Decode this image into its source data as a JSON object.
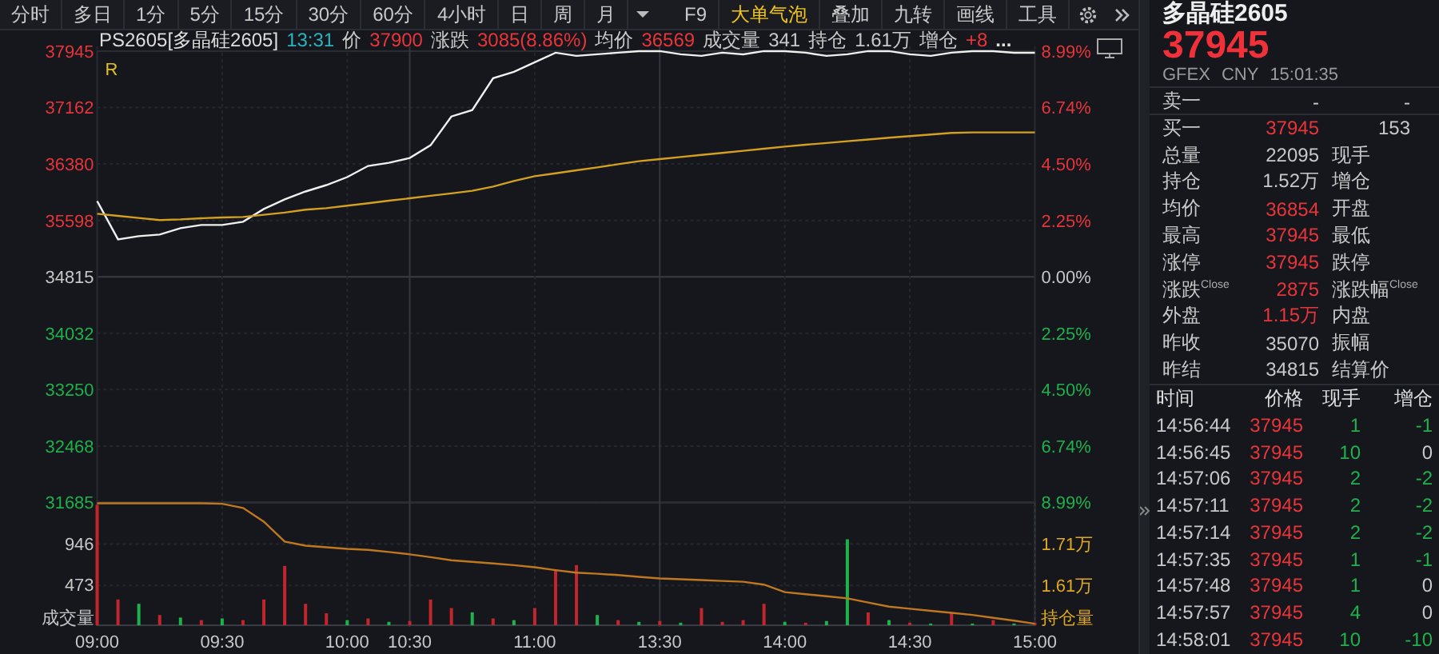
{
  "toolbar": {
    "items": [
      {
        "label": "分时",
        "active": false
      },
      {
        "label": "多日",
        "active": false
      },
      {
        "label": "1分",
        "active": false
      },
      {
        "label": "5分",
        "active": false
      },
      {
        "label": "15分",
        "active": false
      },
      {
        "label": "30分",
        "active": false
      },
      {
        "label": "60分",
        "active": false
      },
      {
        "label": "4小时",
        "active": false
      },
      {
        "label": "日",
        "active": false
      },
      {
        "label": "周",
        "active": false
      },
      {
        "label": "月",
        "active": false
      }
    ],
    "right_items": [
      {
        "label": "F9",
        "active": false
      },
      {
        "label": "大单气泡",
        "active": true
      },
      {
        "label": "叠加",
        "active": false
      },
      {
        "label": "九转",
        "active": false
      },
      {
        "label": "画线",
        "active": false
      },
      {
        "label": "工具",
        "active": false
      }
    ]
  },
  "info": {
    "code": "PS2605[多晶硅2605]",
    "time": "13:31",
    "fields": [
      {
        "label": "价",
        "value": "37900",
        "color": "#e8353a"
      },
      {
        "label": "涨跌",
        "value": "3085(8.86%)",
        "color": "#e8353a"
      },
      {
        "label": "均价",
        "value": "36569",
        "color": "#e8353a"
      },
      {
        "label": "成交量",
        "value": "341",
        "color": "#c8c8c8"
      },
      {
        "label": "持仓",
        "value": "1.61万",
        "color": "#c8c8c8"
      },
      {
        "label": "增仓",
        "value": "+8",
        "color": "#e8353a"
      }
    ],
    "overflow": "..."
  },
  "chart": {
    "marker": "R",
    "percent_labels": [
      {
        "text": "8.99%",
        "color": "#e8353a"
      },
      {
        "text": "6.74%",
        "color": "#e8353a"
      },
      {
        "text": "4.50%",
        "color": "#e8353a"
      },
      {
        "text": "2.25%",
        "color": "#e8353a"
      },
      {
        "text": "0.00%",
        "color": "#c8c8c8"
      },
      {
        "text": "2.25%",
        "color": "#1fb14b"
      },
      {
        "text": "4.50%",
        "color": "#1fb14b"
      },
      {
        "text": "6.74%",
        "color": "#1fb14b"
      },
      {
        "text": "8.99%",
        "color": "#1fb14b"
      }
    ],
    "chart_data": {
      "type": "line",
      "ylim": [
        31685,
        37945
      ],
      "yticks": [
        37945,
        37162,
        36380,
        35598,
        34815,
        34032,
        33250,
        32468,
        31685
      ],
      "series": [
        {
          "color": "#f0f0f0",
          "values": [
            35866,
            35335,
            35379,
            35401,
            35490,
            35534,
            35534,
            35578,
            35755,
            35888,
            35998,
            36087,
            36198,
            36352,
            36397,
            36463,
            36640,
            37038,
            37126,
            37569,
            37657,
            37790,
            37923,
            37879,
            37901,
            37923,
            37945,
            37945,
            37901,
            37879,
            37923,
            37901,
            37945,
            37945,
            37923,
            37879,
            37901,
            37945,
            37945,
            37901,
            37879,
            37923,
            37945,
            37945,
            37923,
            37923
          ]
        },
        {
          "color": "#d4a020",
          "values": [
            35689,
            35660,
            35631,
            35602,
            35611,
            35627,
            35638,
            35645,
            35676,
            35707,
            35746,
            35766,
            35802,
            35835,
            35870,
            35903,
            35939,
            35972,
            36007,
            36067,
            36144,
            36211,
            36251,
            36293,
            36333,
            36377,
            36419,
            36447,
            36476,
            36505,
            36534,
            36562,
            36591,
            36620,
            36647,
            36671,
            36695,
            36720,
            36744,
            36766,
            36788,
            36810,
            36817,
            36817,
            36817,
            36817
          ]
        }
      ]
    }
  },
  "volume": {
    "chart_data": {
      "type": "bar",
      "ylabel": "成交量",
      "ylim": [
        0,
        1428
      ],
      "yticks": [
        946,
        473
      ],
      "categories": [
        "09:00",
        null,
        null,
        null,
        null,
        null,
        "09:30",
        null,
        null,
        null,
        null,
        null,
        "10:00",
        null,
        null,
        "10:30",
        null,
        null,
        null,
        null,
        null,
        "11:00",
        null,
        null,
        null,
        null,
        null,
        "13:30",
        null,
        null,
        null,
        null,
        null,
        "14:00",
        null,
        null,
        null,
        null,
        null,
        "14:30",
        null,
        null,
        null,
        null,
        null,
        "15:00"
      ],
      "series": [
        {
          "color": "#c0262c",
          "values": [
            1400,
            300,
            null,
            120,
            null,
            60,
            null,
            60,
            300,
            690,
            250,
            140,
            null,
            80,
            null,
            50,
            300,
            200,
            null,
            80,
            null,
            200,
            650,
            700,
            null,
            60,
            null,
            50,
            null,
            200,
            40,
            60,
            250,
            null,
            30,
            null,
            null,
            150,
            null,
            30,
            null,
            150,
            null,
            60,
            null,
            30
          ]
        },
        {
          "color": "#1fb14b",
          "values": [
            null,
            null,
            250,
            null,
            90,
            null,
            80,
            null,
            null,
            null,
            null,
            null,
            60,
            null,
            40,
            null,
            null,
            null,
            150,
            null,
            60,
            null,
            null,
            null,
            120,
            null,
            40,
            null,
            30,
            null,
            null,
            null,
            null,
            40,
            null,
            50,
            1000,
            null,
            60,
            null,
            20,
            null,
            20,
            null,
            20,
            null
          ]
        }
      ]
    }
  },
  "holding": {
    "chart_data": {
      "type": "line",
      "ylabel": "持仓量",
      "ylim": [
        1.514,
        1.81
      ],
      "yticks": [
        {
          "value": 1.71,
          "label": "1.71万"
        },
        {
          "value": 1.61,
          "label": "1.61万"
        }
      ],
      "series": [
        {
          "color": "#c07820",
          "values": [
            1.808,
            1.808,
            1.808,
            1.808,
            1.808,
            1.808,
            1.807,
            1.797,
            1.764,
            1.716,
            1.706,
            1.702,
            1.698,
            1.696,
            1.691,
            1.685,
            1.678,
            1.671,
            1.667,
            1.663,
            1.659,
            1.654,
            1.647,
            1.641,
            1.638,
            1.635,
            1.631,
            1.627,
            1.625,
            1.623,
            1.621,
            1.619,
            1.612,
            1.594,
            1.589,
            1.584,
            1.579,
            1.569,
            1.559,
            1.554,
            1.549,
            1.544,
            1.539,
            1.532,
            1.525,
            1.518
          ]
        }
      ]
    }
  },
  "quote": {
    "name": "多晶硅2605",
    "price": "37945",
    "meta": [
      "GFEX",
      "CNY",
      "15:01:35"
    ],
    "book": [
      {
        "label": "卖一",
        "price": "-",
        "qty": "-",
        "color": "#c8c8c8"
      },
      {
        "label": "买一",
        "price": "37945",
        "qty": "153",
        "color": "#e8353a"
      }
    ],
    "stats": [
      {
        "label": "总量",
        "value": "22095",
        "color": "#c8c8c8",
        "label2": "现手"
      },
      {
        "label": "持仓",
        "value": "1.52万",
        "color": "#c8c8c8",
        "label2": "增仓"
      },
      {
        "label": "均价",
        "value": "36854",
        "color": "#e8353a",
        "label2": "开盘"
      },
      {
        "label": "最高",
        "value": "37945",
        "color": "#e8353a",
        "label2": "最低"
      },
      {
        "label": "涨停",
        "value": "37945",
        "color": "#e8353a",
        "label2": "跌停"
      },
      {
        "label": "涨跌$^{Close}$",
        "value": "2875",
        "color": "#e8353a",
        "label2": "涨跌幅$^{Close}$"
      },
      {
        "label": "外盘",
        "value": "1.15万",
        "color": "#e8353a",
        "label2": "内盘"
      },
      {
        "label": "昨收",
        "value": "35070",
        "color": "#c8c8c8",
        "label2": "振幅"
      },
      {
        "label": "昨结",
        "value": "34815",
        "color": "#c8c8c8",
        "label2": "结算价"
      }
    ]
  },
  "trades": {
    "columns": [
      "时间",
      "价格",
      "现手",
      "增仓"
    ],
    "rows": [
      {
        "time": "14:56:44",
        "price": "37945",
        "volume": "1",
        "change": "-1",
        "color": "#1fb14b"
      },
      {
        "time": "14:56:45",
        "price": "37945",
        "volume": "10",
        "change": "0",
        "color": "#c8c8c8"
      },
      {
        "time": "14:57:06",
        "price": "37945",
        "volume": "2",
        "change": "-2",
        "color": "#1fb14b"
      },
      {
        "time": "14:57:11",
        "price": "37945",
        "volume": "2",
        "change": "-2",
        "color": "#1fb14b"
      },
      {
        "time": "14:57:14",
        "price": "37945",
        "volume": "2",
        "change": "-2",
        "color": "#1fb14b"
      },
      {
        "time": "14:57:35",
        "price": "37945",
        "volume": "1",
        "change": "-1",
        "color": "#1fb14b"
      },
      {
        "time": "14:57:48",
        "price": "37945",
        "volume": "1",
        "change": "0",
        "color": "#c8c8c8"
      },
      {
        "time": "14:57:57",
        "price": "37945",
        "volume": "4",
        "change": "0",
        "color": "#c8c8c8"
      },
      {
        "time": "14:58:01",
        "price": "37945",
        "volume": "10",
        "change": "-10",
        "color": "#1fb14b"
      }
    ]
  }
}
